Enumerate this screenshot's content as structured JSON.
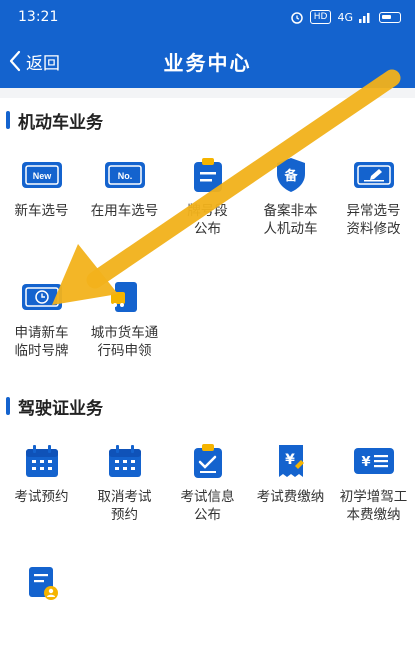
{
  "status": {
    "time": "13:21",
    "hd": "HD",
    "signal": "4G"
  },
  "nav": {
    "back_label": "返回",
    "title": "业务中心"
  },
  "sections": [
    {
      "title": "机动车业务",
      "items": [
        {
          "label": "新车选号",
          "icon": "new-plate-icon"
        },
        {
          "label": "在用车选号",
          "icon": "no-plate-icon"
        },
        {
          "label": "牌号段\n公布",
          "icon": "plate-range-icon"
        },
        {
          "label": "备案非本\n人机动车",
          "icon": "record-shield-icon"
        },
        {
          "label": "异常选号\n资料修改",
          "icon": "edit-card-icon"
        },
        {
          "label": "申请新车\n临时号牌",
          "icon": "temp-plate-icon"
        },
        {
          "label": "城市货车通\n行码申领",
          "icon": "truck-pass-icon"
        }
      ]
    },
    {
      "title": "驾驶证业务",
      "items": [
        {
          "label": "考试预约",
          "icon": "calendar-icon"
        },
        {
          "label": "取消考试\n预约",
          "icon": "calendar-cancel-icon"
        },
        {
          "label": "考试信息\n公布",
          "icon": "exam-info-icon"
        },
        {
          "label": "考试费缴纳",
          "icon": "exam-fee-icon"
        },
        {
          "label": "初学增驾工\n本费缴纳",
          "icon": "fee-list-icon"
        },
        {
          "label": "",
          "icon": "user-doc-icon"
        }
      ]
    }
  ],
  "colors": {
    "primary": "#1463ce",
    "accent": "#f5b400",
    "arrow": "#f2b21b"
  }
}
